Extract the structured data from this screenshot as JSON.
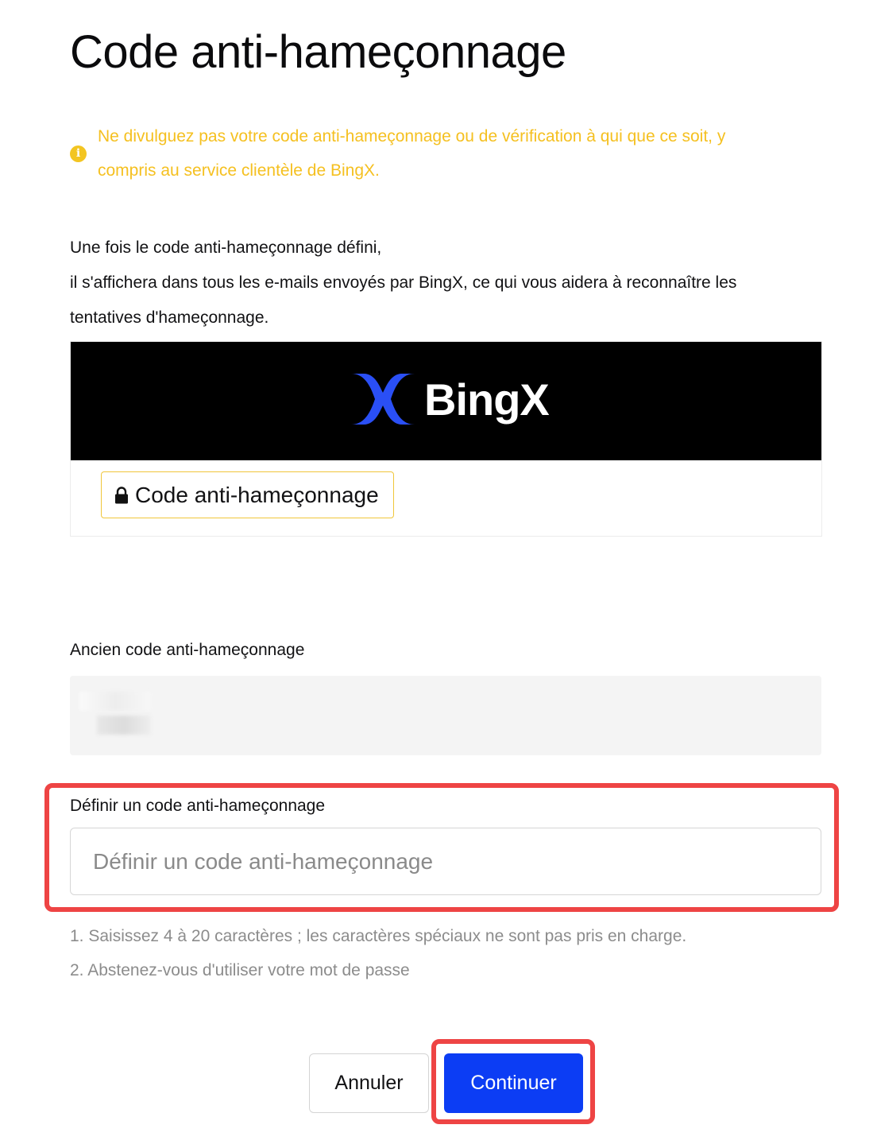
{
  "page": {
    "title": "Code anti-hameçonnage"
  },
  "warning": {
    "icon": "info-icon",
    "text": "Ne divulguez pas votre code anti-hameçonnage ou de vérification à qui que ce soit, y compris au service clientèle de BingX.",
    "color": "#f5c020"
  },
  "description": {
    "line1": "Une fois le code anti-hameçonnage défini,",
    "line2": "il s'affichera dans tous les e-mails envoyés par BingX, ce qui vous aidera à reconnaître les",
    "line3": "tentatives d'hameçonnage."
  },
  "preview": {
    "brand": "BingX",
    "brand_color": "#2a4ff5",
    "chip_icon": "lock-icon",
    "chip_label": "Code anti-hameçonnage"
  },
  "old_code": {
    "label": "Ancien code anti-hameçonnage"
  },
  "new_code": {
    "label": "Définir un code anti-hameçonnage",
    "placeholder": "Définir un code anti-hameçonnage",
    "value": ""
  },
  "rules": {
    "rule1": "1. Saisissez 4 à 20 caractères ; les caractères spéciaux ne sont pas pris en charge.",
    "rule2": "2. Abstenez-vous d'utiliser votre mot de passe"
  },
  "actions": {
    "cancel_label": "Annuler",
    "continue_label": "Continuer",
    "primary_color": "#0c3df4",
    "highlight_color": "#ee4444"
  }
}
